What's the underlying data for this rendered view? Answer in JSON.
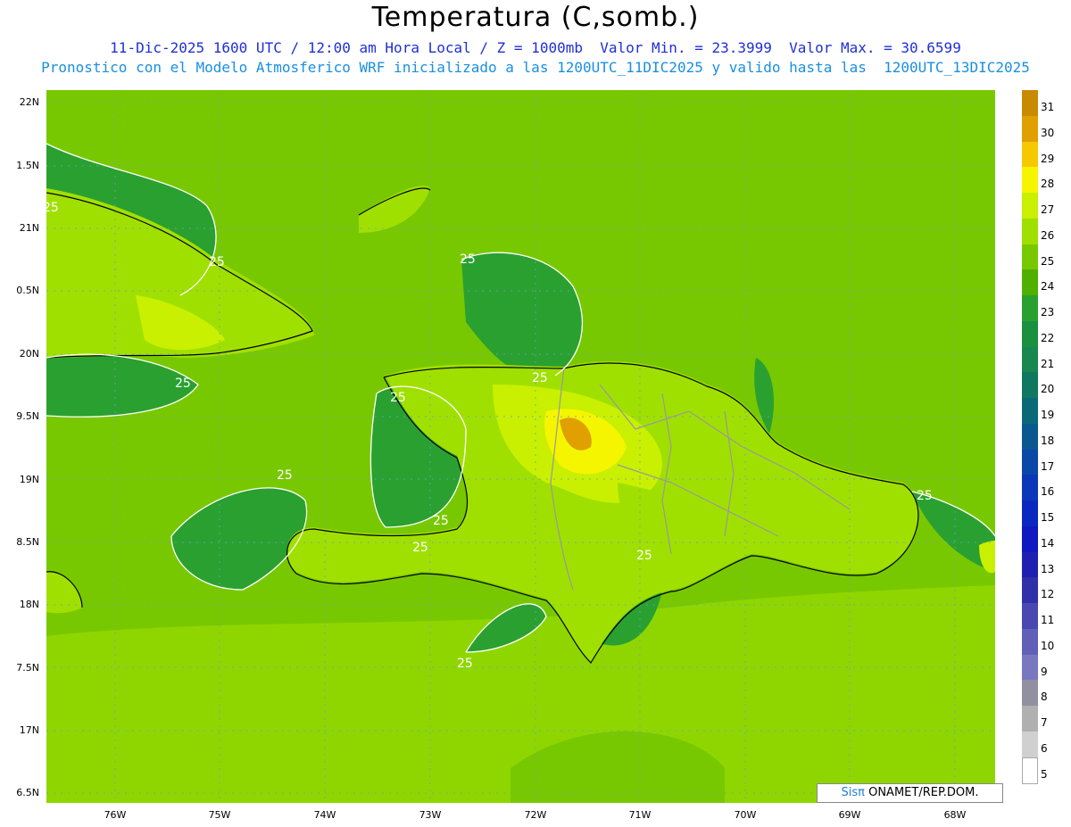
{
  "title": "Temperatura (C,somb.)",
  "subtitle_line1": "11-Dic-2025 1600 UTC / 12:00 am Hora Local / Z = 1000mb  Valor Min. = 23.3999  Valor Max. = 30.6599",
  "subtitle_line2": "Pronostico con el Modelo Atmosferico WRF inicializado a las 1200UTC_11DIC2025 y valido hasta las  1200UTC_13DIC2025",
  "lat_ticks": [
    "22N",
    "1.5N",
    "21N",
    "0.5N",
    "20N",
    "9.5N",
    "19N",
    "8.5N",
    "18N",
    "7.5N",
    "17N",
    "6.5N"
  ],
  "lon_ticks": [
    "76W",
    "75W",
    "74W",
    "73W",
    "72W",
    "71W",
    "70W",
    "69W",
    "68W"
  ],
  "contour_labels": [
    "25",
    "25",
    "25",
    "25",
    "25",
    "25",
    "25",
    "25",
    "25",
    "25",
    "25",
    "25"
  ],
  "colorbar": {
    "labels": [
      "31",
      "30",
      "29",
      "28",
      "27",
      "26",
      "25",
      "24",
      "23",
      "22",
      "21",
      "20",
      "19",
      "18",
      "17",
      "16",
      "15",
      "14",
      "13",
      "12",
      "11",
      "10",
      "9",
      "8",
      "7",
      "6",
      "5"
    ],
    "colors": [
      "#c88a00",
      "#e0a000",
      "#f5c800",
      "#f5f500",
      "#c8f000",
      "#a0e000",
      "#78c800",
      "#50b000",
      "#2aa030",
      "#1a9040",
      "#188850",
      "#107860",
      "#0a6878",
      "#0a5890",
      "#0a48a8",
      "#0a38b8",
      "#0a28c0",
      "#1018c0",
      "#2020b0",
      "#3030a8",
      "#4848b0",
      "#6060b8",
      "#7878c0",
      "#9090a0",
      "#b0b0b0",
      "#d0d0d0",
      "#ffffff"
    ]
  },
  "credit_brand": "Sisπ",
  "credit_text": " ONAMET/REP.DOM."
}
